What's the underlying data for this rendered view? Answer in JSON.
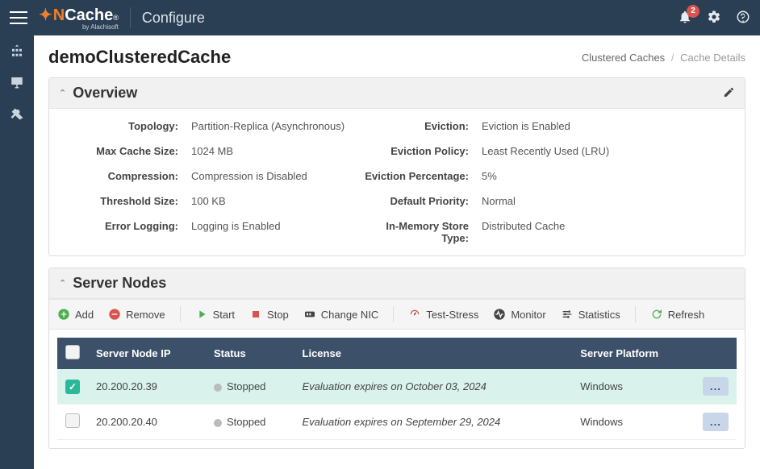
{
  "navbar": {
    "brand_n": "N",
    "brand_rest": "Cache",
    "brand_reg": "®",
    "brand_sub": "by Alachisoft",
    "configure": "Configure",
    "notif_count": "2"
  },
  "page": {
    "title": "demoClusteredCache",
    "breadcrumb_parent": "Clustered Caches",
    "breadcrumb_current": "Cache Details"
  },
  "overview": {
    "panel_title": "Overview",
    "labels": {
      "topology": "Topology:",
      "max_cache_size": "Max Cache Size:",
      "compression": "Compression:",
      "threshold_size": "Threshold Size:",
      "error_logging": "Error Logging:",
      "eviction": "Eviction:",
      "eviction_policy": "Eviction Policy:",
      "eviction_percentage": "Eviction Percentage:",
      "default_priority": "Default Priority:",
      "in_memory_store_type": "In-Memory Store Type:"
    },
    "values": {
      "topology": "Partition-Replica (Asynchronous)",
      "max_cache_size": "1024 MB",
      "compression": "Compression is Disabled",
      "threshold_size": "100 KB",
      "error_logging": "Logging is Enabled",
      "eviction": "Eviction is Enabled",
      "eviction_policy": "Least Recently Used (LRU)",
      "eviction_percentage": "5%",
      "default_priority": "Normal",
      "in_memory_store_type": "Distributed Cache"
    }
  },
  "server_nodes": {
    "panel_title": "Server Nodes",
    "toolbar": {
      "add": "Add",
      "remove": "Remove",
      "start": "Start",
      "stop": "Stop",
      "change_nic": "Change NIC",
      "test_stress": "Test-Stress",
      "monitor": "Monitor",
      "statistics": "Statistics",
      "refresh": "Refresh"
    },
    "columns": {
      "ip": "Server Node IP",
      "status": "Status",
      "license": "License",
      "platform": "Server Platform"
    },
    "rows": [
      {
        "selected": true,
        "ip": "20.200.20.39",
        "status": "Stopped",
        "license": "Evaluation expires on October 03, 2024",
        "platform": "Windows"
      },
      {
        "selected": false,
        "ip": "20.200.20.40",
        "status": "Stopped",
        "license": "Evaluation expires on September 29, 2024",
        "platform": "Windows"
      }
    ],
    "menu_label": "..."
  }
}
